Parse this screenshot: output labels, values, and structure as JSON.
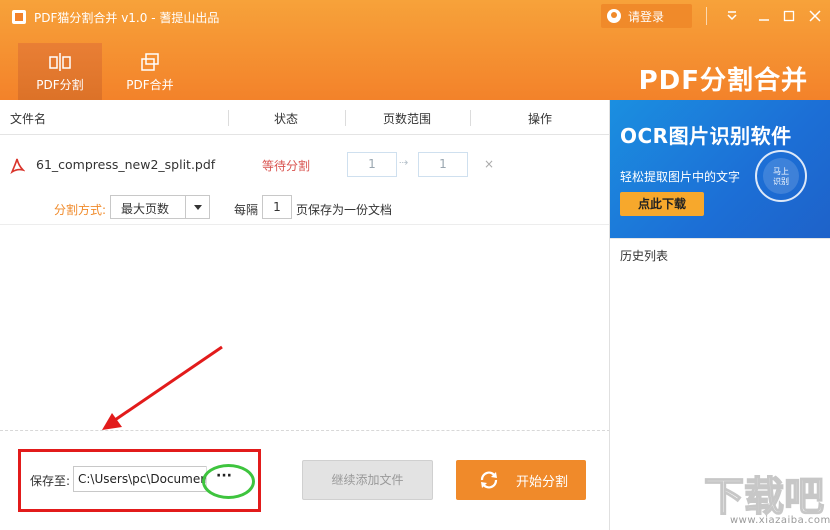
{
  "window": {
    "title": "PDF猫分割合并 v1.0 - 蓍提山出品",
    "login_label": "请登录"
  },
  "tabs": [
    {
      "label": "PDF分割",
      "active": true
    },
    {
      "label": "PDF合并",
      "active": false
    }
  ],
  "brand": {
    "text": "PDF分割合并"
  },
  "table": {
    "headers": [
      "文件名",
      "状态",
      "页数范围",
      "操作"
    ],
    "rows": [
      {
        "file_name": "61_compress_new2_split.pdf",
        "status": "等待分割",
        "range_from": "1",
        "range_to": "1",
        "action": "×"
      }
    ]
  },
  "split_options": {
    "mode_label": "分割方式:",
    "mode_value": "最大页数",
    "every_label": "每隔",
    "pages_value": "1",
    "save_as_label": "页保存为一份文档"
  },
  "bottom": {
    "save_to_label": "保存至:",
    "path_value": "C:\\Users\\pc\\Documents",
    "browse_label": "···",
    "continue_label": "继续添加文件",
    "start_label": "开始分割"
  },
  "ad": {
    "title": "OCR图片识别软件",
    "subtitle": "轻松提取图片中的文字",
    "cta": "点此下载",
    "badge_line1": "马上",
    "badge_line2": "识别"
  },
  "history": {
    "label": "历史列表"
  },
  "watermark": {
    "text": "www.xiazaiba.com"
  },
  "colors": {
    "header": "#f3822a",
    "accent": "#f08a2a",
    "status": "#d9534f",
    "ad_blue": "#1c6fd6",
    "annotation_red": "#e21b1b",
    "annotation_green": "#3ec43e"
  }
}
